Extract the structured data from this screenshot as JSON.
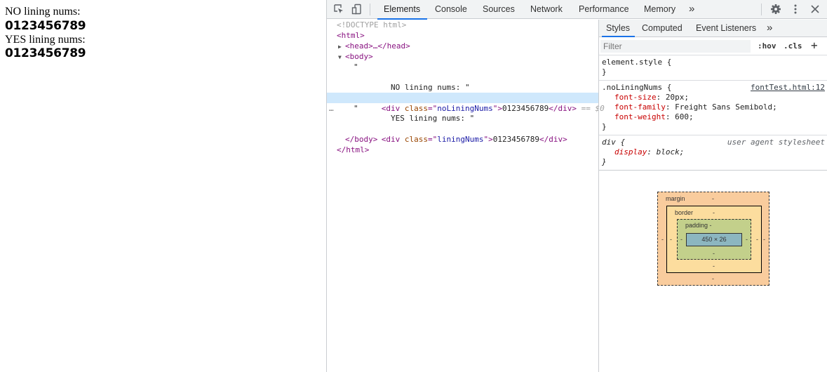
{
  "page": {
    "items": [
      {
        "label": "NO lining nums:",
        "nums": "0123456789"
      },
      {
        "label": "YES lining nums:",
        "nums": "0123456789"
      }
    ]
  },
  "devtools": {
    "tabs": [
      "Elements",
      "Console",
      "Sources",
      "Network",
      "Performance",
      "Memory"
    ],
    "more_tabs": "»",
    "icons": [
      "inspect-icon",
      "device-toggle-icon",
      "gear-icon",
      "kebab-menu-icon",
      "close-icon"
    ],
    "elements": {
      "doctype": "<!DOCTYPE html>",
      "html_open": "<html>",
      "head": "<head>…</head>",
      "body_open": "<body>",
      "quote1": "\"",
      "text1": "NO lining nums: \"",
      "div1_class": "noLiningNums",
      "div1_text": "0123456789",
      "selected_marker": "== $0",
      "dots": "…",
      "quote2": "\"",
      "text2": "YES lining nums: \"",
      "div2_class": "liningNums",
      "div2_text": "0123456789",
      "body_close": "</body>",
      "html_close": "</html>"
    },
    "styles": {
      "subtabs": [
        "Styles",
        "Computed",
        "Event Listeners"
      ],
      "subtabs_more": "»",
      "filter_placeholder": "Filter",
      "hov": ":hov",
      "cls": ".cls",
      "add": "+",
      "rules": [
        {
          "selector": "element.style {",
          "source": "",
          "decls": [],
          "close": "}"
        },
        {
          "selector": ".noLiningNums {",
          "source": "fontTest.html:12",
          "decls": [
            {
              "prop": "font-size",
              "value": "20px;"
            },
            {
              "prop": "font-family",
              "value": "Freight Sans Semibold;"
            },
            {
              "prop": "font-weight",
              "value": "600;"
            }
          ],
          "close": "}"
        },
        {
          "selector": "div {",
          "source": "user agent stylesheet",
          "decls": [
            {
              "prop": "display",
              "value": "block;"
            }
          ],
          "close": "}"
        }
      ],
      "box_model": {
        "margin_label": "margin",
        "border_label": "border",
        "padding_label": "padding -",
        "content": "450 × 26",
        "dash": "-"
      }
    }
  }
}
